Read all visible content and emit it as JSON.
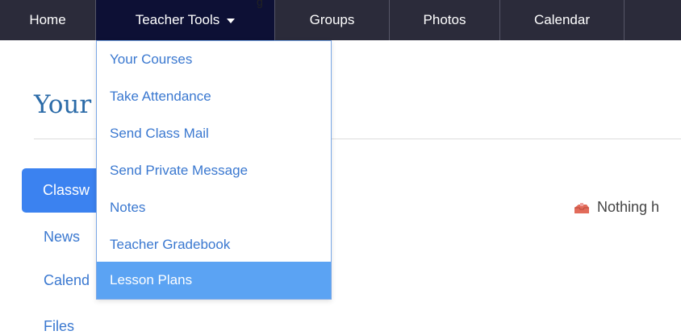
{
  "cut_top_text": "g",
  "nav": {
    "items": [
      {
        "label": "Home"
      },
      {
        "label": "Teacher Tools"
      },
      {
        "label": "Groups"
      },
      {
        "label": "Photos"
      },
      {
        "label": "Calendar"
      },
      {
        "label": ""
      }
    ]
  },
  "dropdown": {
    "items": [
      {
        "label": "Your Courses"
      },
      {
        "label": "Take Attendance"
      },
      {
        "label": "Send Class Mail"
      },
      {
        "label": "Send Private Message"
      },
      {
        "label": "Notes"
      },
      {
        "label": "Teacher Gradebook"
      },
      {
        "label": "Lesson Plans"
      }
    ],
    "highlighted_item": "Lesson Plans"
  },
  "page": {
    "heading": "Your"
  },
  "sidebar": {
    "items": [
      {
        "label": "Classw"
      },
      {
        "label": "News"
      },
      {
        "label": "Calend"
      },
      {
        "label": "Files"
      }
    ],
    "active_item": "Classw"
  },
  "empty_state": {
    "text": "Nothing h",
    "icon": "empty-bin-icon"
  },
  "colors": {
    "nav_background": "#2b2b3a",
    "nav_active": "#0d1035",
    "link_blue": "#3a78d0",
    "active_blue": "#3b82f0",
    "highlight_blue": "#5ba3f3",
    "heading_blue": "#2b6ba8"
  }
}
